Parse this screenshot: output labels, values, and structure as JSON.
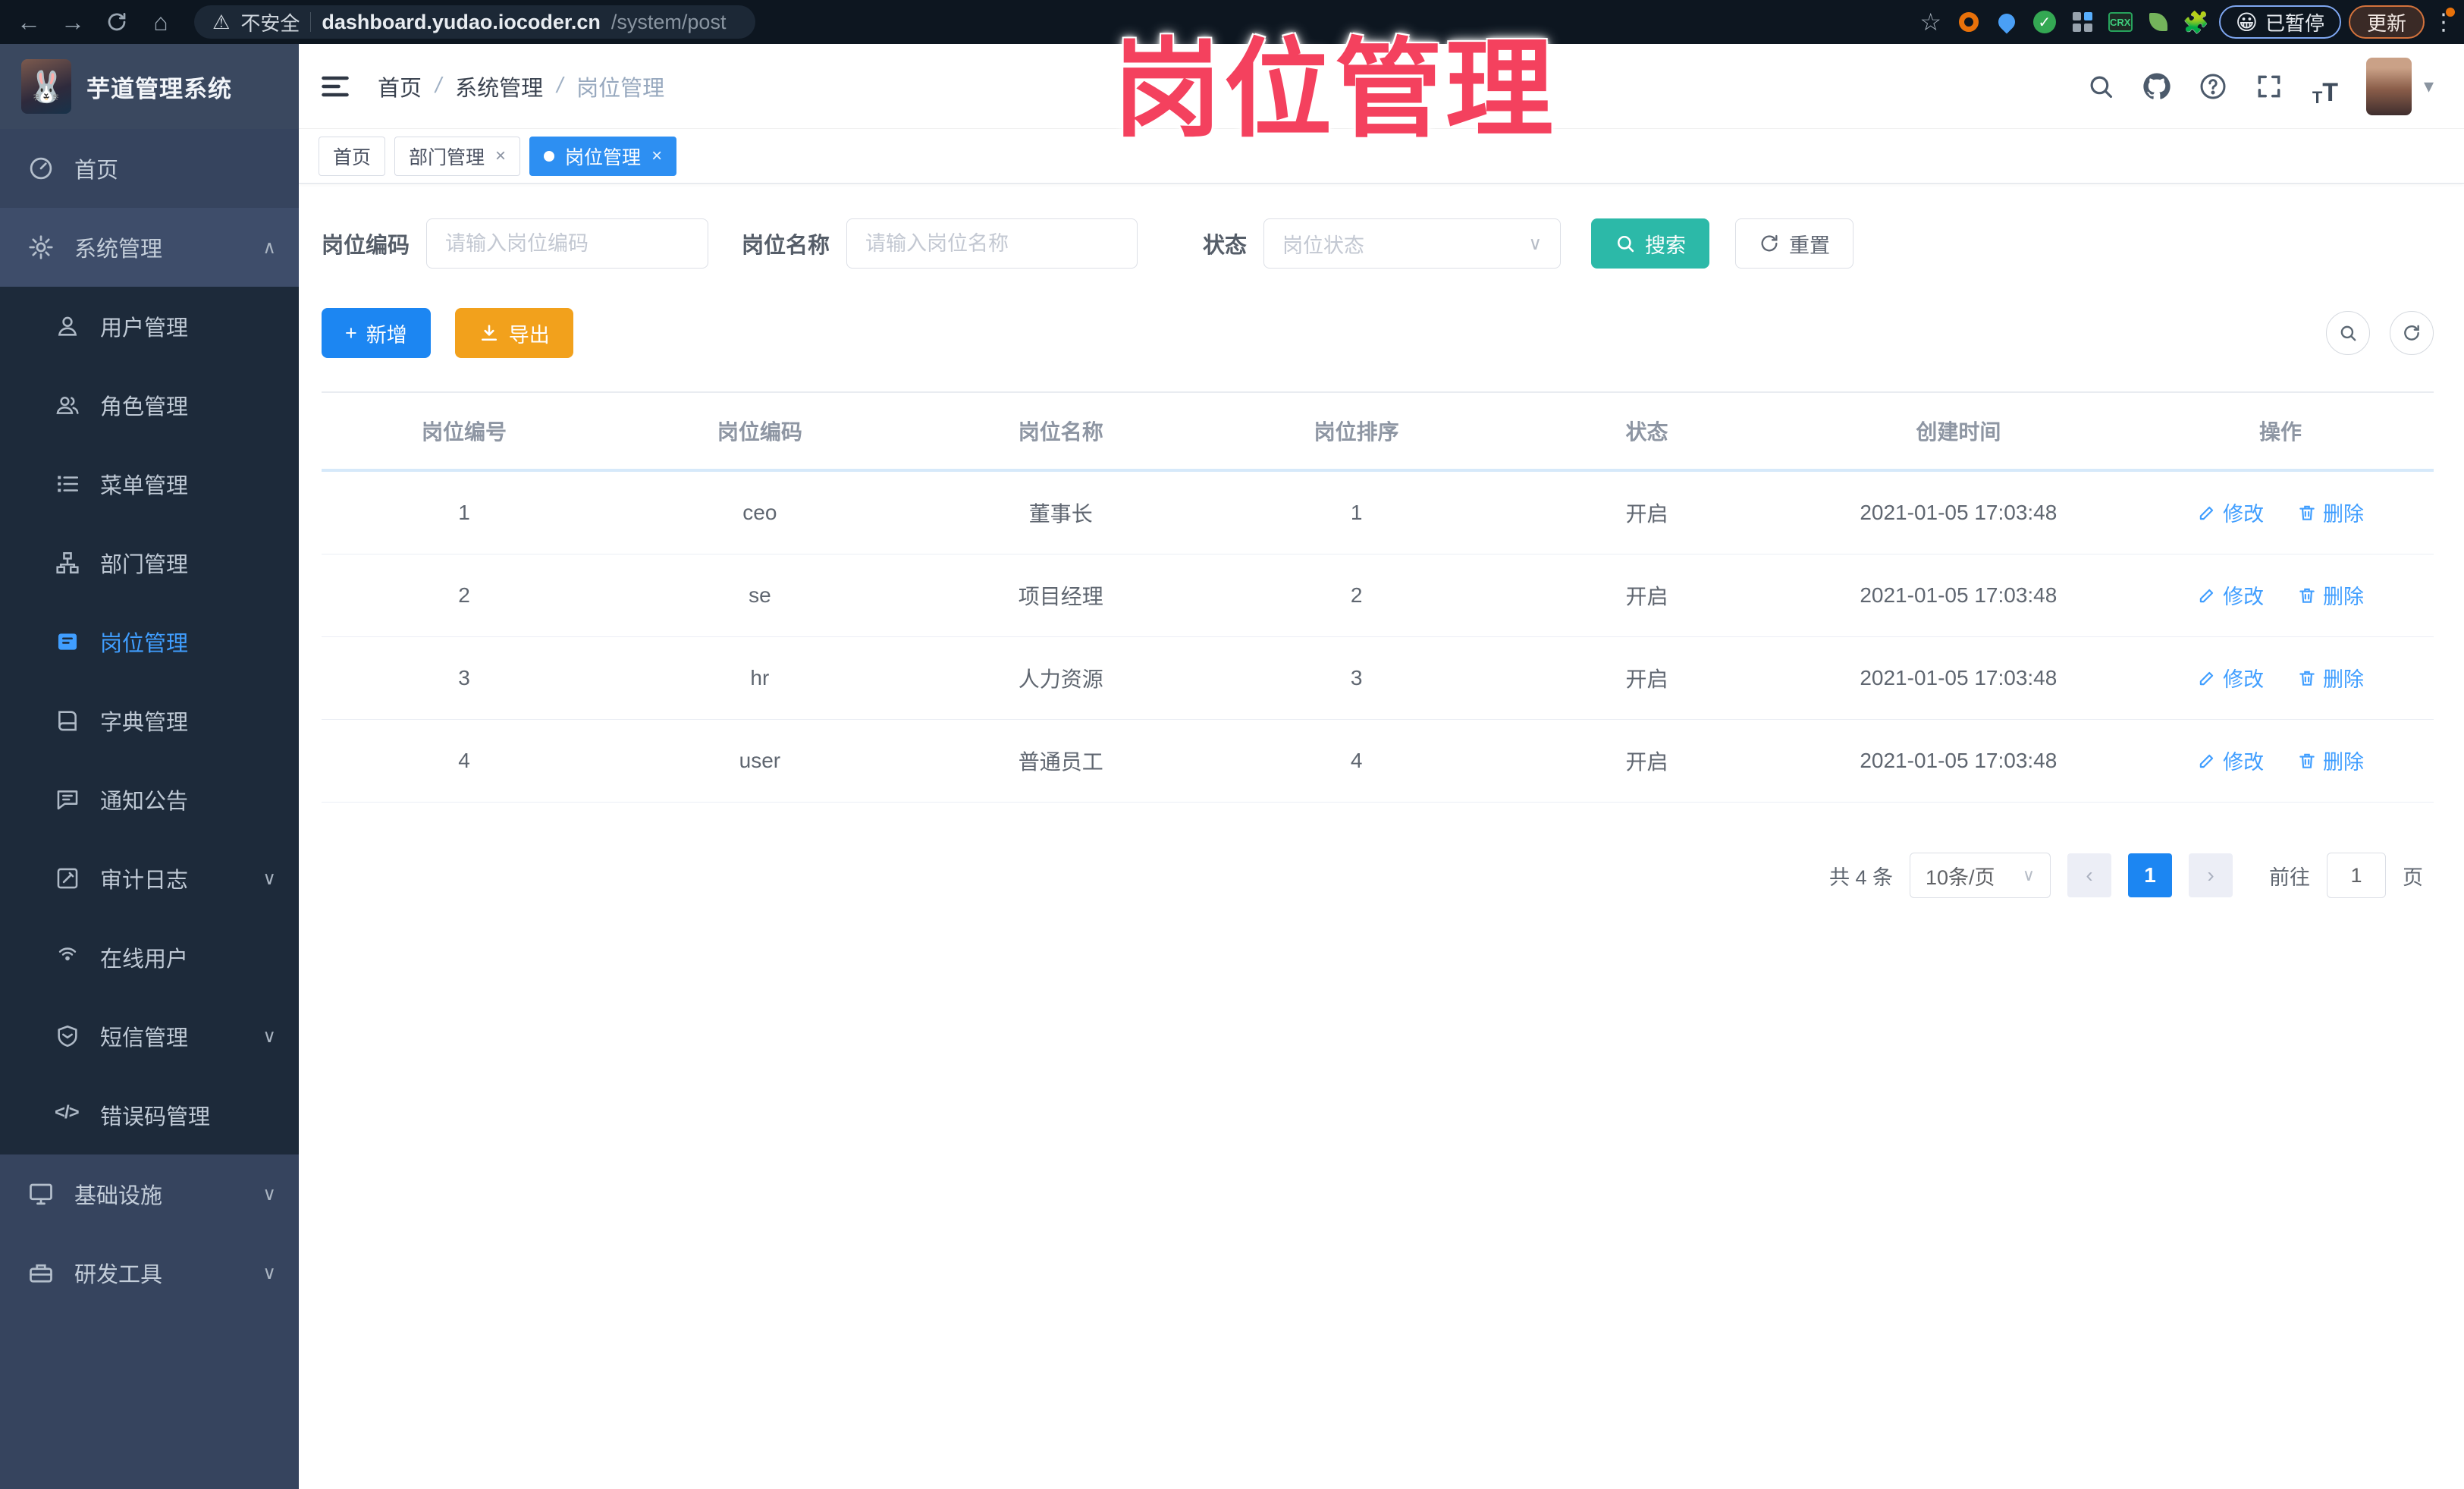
{
  "browser": {
    "unsafe_label": "不安全",
    "url_domain": "dashboard.yudao.iocoder.cn",
    "url_path": "/system/post",
    "paused_label": "已暂停",
    "update_label": "更新",
    "crx_label": "CRX"
  },
  "icons": {
    "back": "←",
    "forward": "→",
    "home": "⌂",
    "warning": "⚠",
    "star": "☆",
    "puzzle": "🧩",
    "emoji_paused": "😀",
    "dots": "⋮",
    "caret_down": "▾",
    "chevron_up": "∧",
    "chevron_down": "∨",
    "select_caret": "∨",
    "close": "×",
    "plus": "+",
    "question": "?",
    "slash": "/",
    "errcode": "</>",
    "font_small": "T",
    "font_big": "T",
    "check": "✓"
  },
  "sidebar": {
    "title": "芋道管理系统",
    "items": [
      {
        "label": "首页"
      },
      {
        "label": "系统管理"
      },
      {
        "label": "用户管理"
      },
      {
        "label": "角色管理"
      },
      {
        "label": "菜单管理"
      },
      {
        "label": "部门管理"
      },
      {
        "label": "岗位管理"
      },
      {
        "label": "字典管理"
      },
      {
        "label": "通知公告"
      },
      {
        "label": "审计日志"
      },
      {
        "label": "在线用户"
      },
      {
        "label": "短信管理"
      },
      {
        "label": "错误码管理"
      },
      {
        "label": "基础设施"
      },
      {
        "label": "研发工具"
      }
    ]
  },
  "breadcrumb": [
    "首页",
    "系统管理",
    "岗位管理"
  ],
  "tabs": [
    {
      "label": "首页"
    },
    {
      "label": "部门管理"
    },
    {
      "label": "岗位管理"
    }
  ],
  "filters": {
    "code_label": "岗位编码",
    "code_placeholder": "请输入岗位编码",
    "name_label": "岗位名称",
    "name_placeholder": "请输入岗位名称",
    "status_label": "状态",
    "status_placeholder": "岗位状态",
    "search_label": "搜索",
    "reset_label": "重置"
  },
  "toolbar": {
    "add_label": "新增",
    "export_label": "导出"
  },
  "table": {
    "headers": [
      "岗位编号",
      "岗位编码",
      "岗位名称",
      "岗位排序",
      "状态",
      "创建时间",
      "操作"
    ],
    "edit_label": "修改",
    "delete_label": "删除",
    "rows": [
      {
        "id": "1",
        "code": "ceo",
        "name": "董事长",
        "sort": "1",
        "status": "开启",
        "time": "2021-01-05 17:03:48"
      },
      {
        "id": "2",
        "code": "se",
        "name": "项目经理",
        "sort": "2",
        "status": "开启",
        "time": "2021-01-05 17:03:48"
      },
      {
        "id": "3",
        "code": "hr",
        "name": "人力资源",
        "sort": "3",
        "status": "开启",
        "time": "2021-01-05 17:03:48"
      },
      {
        "id": "4",
        "code": "user",
        "name": "普通员工",
        "sort": "4",
        "status": "开启",
        "time": "2021-01-05 17:03:48"
      }
    ]
  },
  "pagination": {
    "total": "共 4 条",
    "page_size": "10条/页",
    "prev": "‹",
    "page": "1",
    "next": "›",
    "goto_label": "前往",
    "goto_value": "1",
    "unit": "页"
  },
  "watermark": "岗位管理",
  "colors": {
    "accent": "#409eff",
    "teal": "#2cb9a8",
    "orange": "#f2a11c",
    "rose": "#f4415e"
  }
}
